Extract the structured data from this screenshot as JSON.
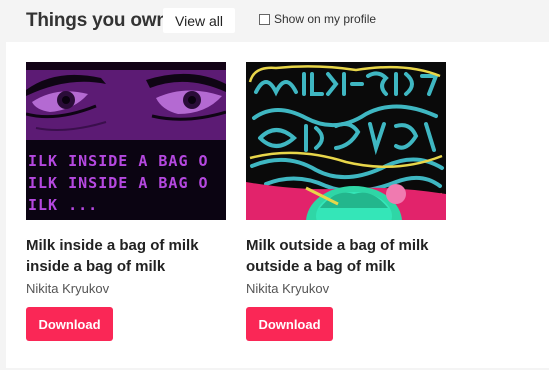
{
  "header": {
    "title": "Things you own",
    "view_all_label": "View all",
    "show_on_profile_label": "Show on my profile",
    "show_on_profile_checked": false
  },
  "items": [
    {
      "title": "Milk inside a bag of milk inside a bag of milk",
      "author": "Nikita Kryukov",
      "download_label": "Download",
      "cover_lines": [
        "ILK INSIDE A BAG O",
        "ILK INSIDE A BAG O",
        "ILK ..."
      ]
    },
    {
      "title": "Milk outside a bag of milk outside a bag of milk",
      "author": "Nikita Kryukov",
      "download_label": "Download"
    }
  ],
  "colors": {
    "accent": "#fa2756",
    "background": "#f4f4f4"
  }
}
